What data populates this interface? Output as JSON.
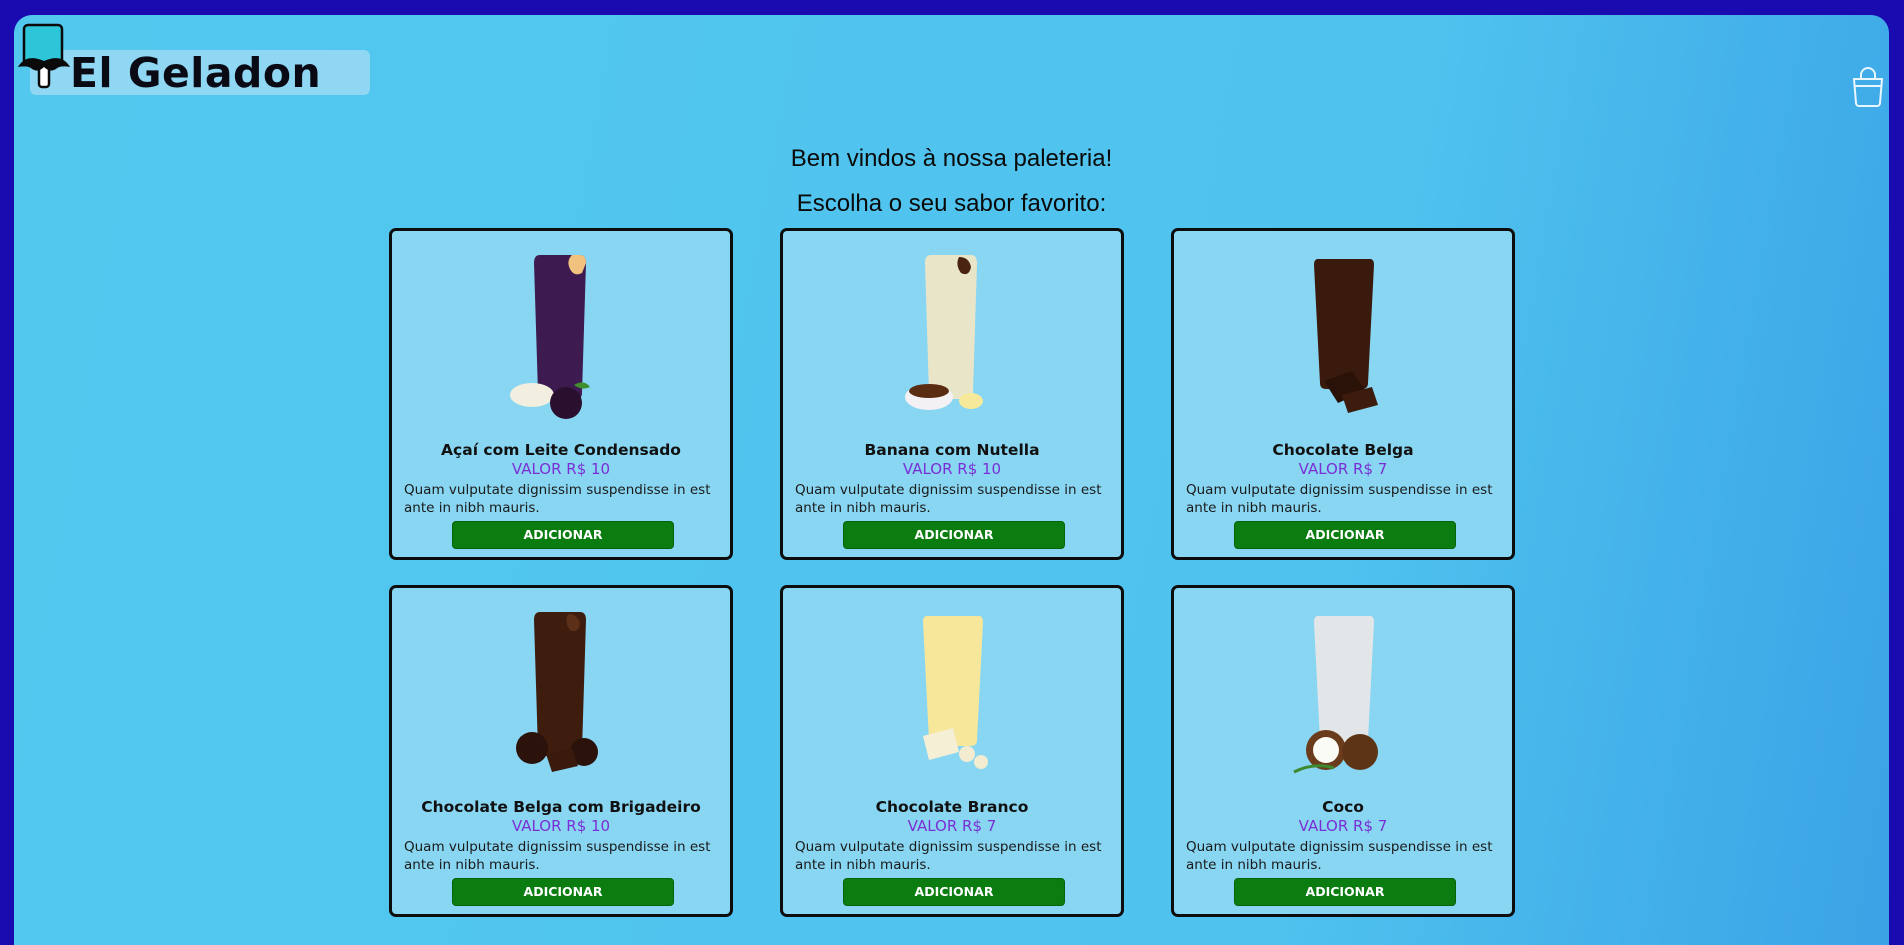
{
  "header": {
    "brand": "El Geladon"
  },
  "intro": {
    "line1": "Bem vindos à nossa paleteria!",
    "line2": "Escolha o seu sabor favorito:"
  },
  "colors": {
    "frame": "#1a0bb0",
    "background": "#52c8ef",
    "card": "#88d6f2",
    "price": "#7a2fd6",
    "button": "#0b7d10"
  },
  "products": [
    {
      "name": "Açaí com Leite Condensado",
      "price": "VALOR R$ 10",
      "description": "Quam vulputate dignissim suspendisse in est ante in nibh mauris.",
      "button": "ADICIONAR",
      "image": "acai-popsicle"
    },
    {
      "name": "Banana com Nutella",
      "price": "VALOR R$ 10",
      "description": "Quam vulputate dignissim suspendisse in est ante in nibh mauris.",
      "button": "ADICIONAR",
      "image": "banana-nutella-popsicle"
    },
    {
      "name": "Chocolate Belga",
      "price": "VALOR R$ 7",
      "description": "Quam vulputate dignissim suspendisse in est ante in nibh mauris.",
      "button": "ADICIONAR",
      "image": "belgian-chocolate-popsicle"
    },
    {
      "name": "Chocolate Belga com Brigadeiro",
      "price": "VALOR R$ 10",
      "description": "Quam vulputate dignissim suspendisse in est ante in nibh mauris.",
      "button": "ADICIONAR",
      "image": "brigadeiro-popsicle"
    },
    {
      "name": "Chocolate Branco",
      "price": "VALOR R$ 7",
      "description": "Quam vulputate dignissim suspendisse in est ante in nibh mauris.",
      "button": "ADICIONAR",
      "image": "white-chocolate-popsicle"
    },
    {
      "name": "Coco",
      "price": "VALOR R$ 7",
      "description": "Quam vulputate dignissim suspendisse in est ante in nibh mauris.",
      "button": "ADICIONAR",
      "image": "coconut-popsicle"
    }
  ]
}
